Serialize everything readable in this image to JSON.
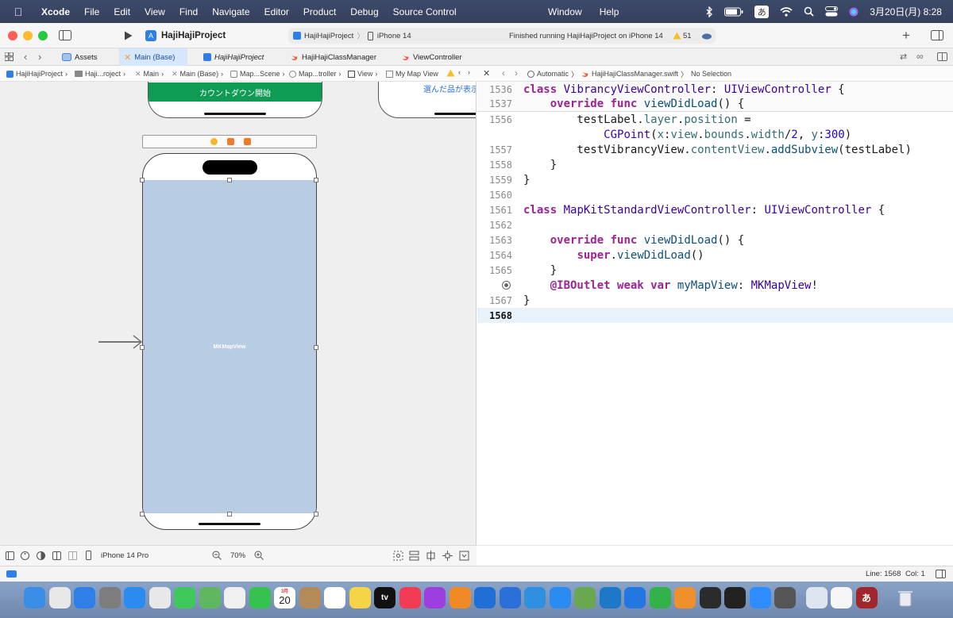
{
  "menubar": {
    "app_name": "Xcode",
    "menus": [
      "File",
      "Edit",
      "View",
      "Find",
      "Navigate",
      "Editor",
      "Product",
      "Debug",
      "Source Control"
    ],
    "center_menus": [
      "Window",
      "Help"
    ],
    "input_method": "あ",
    "clock": "3月20日(月)  8:28"
  },
  "toolbar": {
    "project": "HajiHajiProject",
    "scheme": "HajiHajiProject",
    "device": "iPhone 14",
    "status": "Finished running HajiHajiProject on iPhone 14",
    "warning_count": "51"
  },
  "tabs": [
    {
      "label": "Assets",
      "icon": "assets-icon"
    },
    {
      "label": "Main (Base)",
      "icon": "storyboard-icon"
    },
    {
      "label": "HajiHajiProject",
      "icon": "app-icon"
    },
    {
      "label": "HajiHajiClassManager",
      "icon": "swift-icon"
    },
    {
      "label": "ViewController",
      "icon": "swift-icon"
    }
  ],
  "canvas_jumpbar": [
    "HajiHajiProject",
    "Haji...roject",
    "Main",
    "Main (Base)",
    "Map...Scene",
    "Map...troller",
    "View",
    "My Map View"
  ],
  "editor_jumpbar": {
    "mode": "Automatic",
    "file": "HajiHajiClassManager.swift",
    "selection": "No Selection"
  },
  "canvas": {
    "top_button_label": "カウントダウン開始",
    "top_right_label": "選んだ品が表示",
    "map_view_label": "MKMapView",
    "map_color": "#b8cce4"
  },
  "code": {
    "sticky": [
      {
        "num": "1536",
        "text": "class VibrancyViewController: UIViewController {"
      },
      {
        "num": "1537",
        "text": "    override func viewDidLoad() {"
      }
    ],
    "lines": [
      {
        "num": "1556",
        "text": "        testLabel.layer.position ="
      },
      {
        "num": "",
        "text": "            CGPoint(x:view.bounds.width/2, y:300)"
      },
      {
        "num": "1557",
        "text": "        testVibrancyView.contentView.addSubview(testLabel)"
      },
      {
        "num": "1558",
        "text": "    }"
      },
      {
        "num": "1559",
        "text": "}"
      },
      {
        "num": "1560",
        "text": ""
      },
      {
        "num": "1561",
        "text": "class MapKitStandardViewController: UIViewController {"
      },
      {
        "num": "1562",
        "text": ""
      },
      {
        "num": "1563",
        "text": "    override func viewDidLoad() {"
      },
      {
        "num": "1564",
        "text": "        super.viewDidLoad()"
      },
      {
        "num": "1565",
        "text": "    }"
      },
      {
        "num": "",
        "text": "    @IBOutlet weak var myMapView: MKMapView!"
      },
      {
        "num": "1567",
        "text": "}"
      },
      {
        "num": "1568",
        "text": ""
      }
    ]
  },
  "bottom": {
    "device": "iPhone 14 Pro",
    "zoom": "70%"
  },
  "status": {
    "line": "Line: 1568",
    "col": "Col: 1"
  },
  "dock": [
    {
      "name": "finder-icon",
      "color": "#3a8ee6"
    },
    {
      "name": "launchpad-icon",
      "color": "#e8e8e8"
    },
    {
      "name": "mail-icon",
      "color": "#2f7fe8"
    },
    {
      "name": "system-settings-icon",
      "color": "#7d7d7d"
    },
    {
      "name": "safari-icon",
      "color": "#2a8cf0"
    },
    {
      "name": "chrome-icon",
      "color": "#e8e8e8"
    },
    {
      "name": "messages-icon",
      "color": "#3fc95b"
    },
    {
      "name": "maps-icon",
      "color": "#5fb860"
    },
    {
      "name": "photos-icon",
      "color": "#f0f0f0"
    },
    {
      "name": "facetime-icon",
      "color": "#35c24e"
    },
    {
      "name": "calendar-icon",
      "color": "#ffffff"
    },
    {
      "name": "contacts-icon",
      "color": "#b58a5a"
    },
    {
      "name": "reminders-icon",
      "color": "#ffffff"
    },
    {
      "name": "notes-icon",
      "color": "#f5d547"
    },
    {
      "name": "tv-icon",
      "color": "#111111"
    },
    {
      "name": "music-icon",
      "color": "#f33b55"
    },
    {
      "name": "podcasts-icon",
      "color": "#9c3ee0"
    },
    {
      "name": "books-icon",
      "color": "#f08a24"
    },
    {
      "name": "xcode-icon",
      "color": "#1f6fd6"
    },
    {
      "name": "instruments-icon",
      "color": "#2b6fd8"
    },
    {
      "name": "xcode-alt-icon",
      "color": "#2f8fe0"
    },
    {
      "name": "app-store-icon",
      "color": "#2a8cf0"
    },
    {
      "name": "script-editor-icon",
      "color": "#6aa84f"
    },
    {
      "name": "vscode-icon",
      "color": "#1e78c8"
    },
    {
      "name": "keynote-icon",
      "color": "#2277e0"
    },
    {
      "name": "numbers-icon",
      "color": "#33b24a"
    },
    {
      "name": "pages-icon",
      "color": "#f0902a"
    },
    {
      "name": "activity-icon",
      "color": "#2b2b2b"
    },
    {
      "name": "terminal-icon",
      "color": "#222222"
    },
    {
      "name": "zoom-icon",
      "color": "#2d8cff"
    },
    {
      "name": "calculator-icon",
      "color": "#555555"
    },
    {
      "name": "preview-icon",
      "color": "#dde6f0"
    },
    {
      "name": "textedit-icon",
      "color": "#f5f5f5"
    },
    {
      "name": "dictionary-icon",
      "color": "#a0262b"
    },
    {
      "name": "trash-icon",
      "color": "#d8dde4"
    }
  ],
  "dock_calendar_day": "20",
  "dock_calendar_month": "3月",
  "dock_dictionary_glyph": "あ",
  "dock_tv_label": "tv"
}
